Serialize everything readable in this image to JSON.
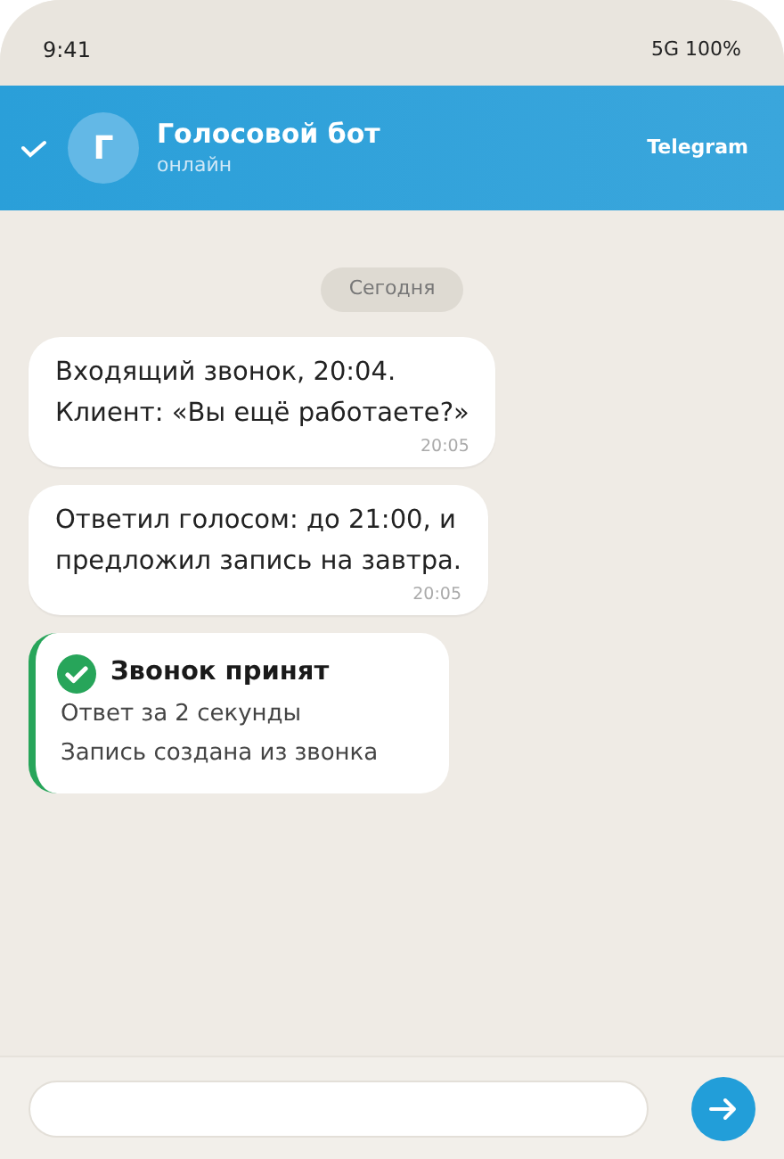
{
  "status_bar": {
    "time": "9:41",
    "indicators": "5G 100%"
  },
  "header": {
    "avatar_letter": "Г",
    "title": "Голосовой бот",
    "subtitle": "онлайн",
    "platform": "Telegram"
  },
  "chat": {
    "date_chip": "Сегодня",
    "messages": [
      {
        "kind": "text",
        "lines": [
          "Входящий звонок, 20:04.",
          "Клиент: «Вы ещё работаете?»"
        ],
        "time": "20:05"
      },
      {
        "kind": "text",
        "lines": [
          "Ответил голосом: до 21:00, и",
          "предложил запись на завтра."
        ],
        "time": "20:05"
      },
      {
        "kind": "status",
        "title": "Звонок принят",
        "lines": [
          "Ответ за 2 секунды",
          "Запись создана из звонка"
        ]
      }
    ]
  }
}
